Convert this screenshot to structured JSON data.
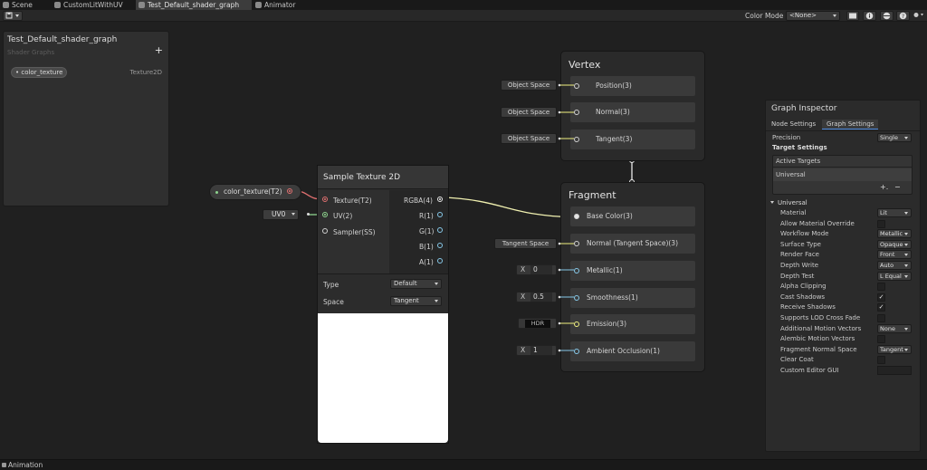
{
  "tabs": [
    {
      "label": "Scene",
      "active": false
    },
    {
      "label": "CustomLitWithUV",
      "active": false
    },
    {
      "label": "Test_Default_shader_graph",
      "active": true
    },
    {
      "label": "Animator",
      "active": false
    }
  ],
  "toolbar": {
    "save_icon": "save-icon",
    "color_mode_label": "Color Mode",
    "color_mode_value": "<None>"
  },
  "blackboard": {
    "title": "Test_Default_shader_graph",
    "subtitle": "Shader Graphs",
    "add_label": "+",
    "property_name": "color_texture",
    "property_type": "Texture2D"
  },
  "property_node": {
    "label": "color_texture(T2)"
  },
  "sample_texture": {
    "title": "Sample Texture 2D",
    "inputs": [
      "Texture(T2)",
      "UV(2)",
      "Sampler(SS)"
    ],
    "outputs": [
      "RGBA(4)",
      "R(1)",
      "G(1)",
      "B(1)",
      "A(1)"
    ],
    "type_label": "Type",
    "type_value": "Default",
    "space_label": "Space",
    "space_value": "Tangent"
  },
  "uv_node": {
    "label": "UV0"
  },
  "vertex": {
    "title": "Vertex",
    "slots": [
      "Position(3)",
      "Normal(3)",
      "Tangent(3)"
    ],
    "inputs": [
      "Object Space",
      "Object Space",
      "Object Space"
    ]
  },
  "fragment": {
    "title": "Fragment",
    "slots": [
      "Base Color(3)",
      "Normal (Tangent Space)(3)",
      "Metallic(1)",
      "Smoothness(1)",
      "Emission(3)",
      "Ambient Occlusion(1)"
    ],
    "normal_input": "Tangent Space",
    "x_label": "X",
    "metallic_value": "0",
    "smoothness_value": "0.5",
    "emission_label": "HDR",
    "ao_value": "1"
  },
  "inspector": {
    "title": "Graph Inspector",
    "tab_node": "Node Settings",
    "tab_graph": "Graph Settings",
    "precision_label": "Precision",
    "precision_value": "Single",
    "target_settings": "Target Settings",
    "active_targets": "Active Targets",
    "target_universal": "Universal",
    "add_label": "+.",
    "remove_label": "−",
    "section_universal": "Universal",
    "rows": [
      {
        "label": "Material",
        "kind": "select",
        "value": "Lit"
      },
      {
        "label": "Allow Material Override",
        "kind": "check",
        "value": ""
      },
      {
        "label": "Workflow Mode",
        "kind": "select",
        "value": "Metallic"
      },
      {
        "label": "Surface Type",
        "kind": "select",
        "value": "Opaque"
      },
      {
        "label": "Render Face",
        "kind": "select",
        "value": "Front"
      },
      {
        "label": "Depth Write",
        "kind": "select",
        "value": "Auto"
      },
      {
        "label": "Depth Test",
        "kind": "select",
        "value": "L Equal"
      },
      {
        "label": "Alpha Clipping",
        "kind": "check",
        "value": ""
      },
      {
        "label": "Cast Shadows",
        "kind": "check",
        "value": "✓"
      },
      {
        "label": "Receive Shadows",
        "kind": "check",
        "value": "✓"
      },
      {
        "label": "Supports LOD Cross Fade",
        "kind": "check",
        "value": ""
      },
      {
        "label": "Additional Motion Vectors",
        "kind": "select",
        "value": "None"
      },
      {
        "label": "Alembic Motion Vectors",
        "kind": "check",
        "value": ""
      },
      {
        "label": "Fragment Normal Space",
        "kind": "select",
        "value": "Tangent"
      },
      {
        "label": "Clear Coat",
        "kind": "check",
        "value": ""
      },
      {
        "label": "Custom Editor GUI",
        "kind": "text",
        "value": ""
      }
    ]
  },
  "bottom": {
    "label": "Animation"
  },
  "colors": {
    "wire_vec4": "#f0f0b0",
    "wire_vec2": "#8ed48e",
    "port_tex": "#e07070",
    "port_float": "#86c8e8",
    "port_vec3": "#f0f080"
  }
}
